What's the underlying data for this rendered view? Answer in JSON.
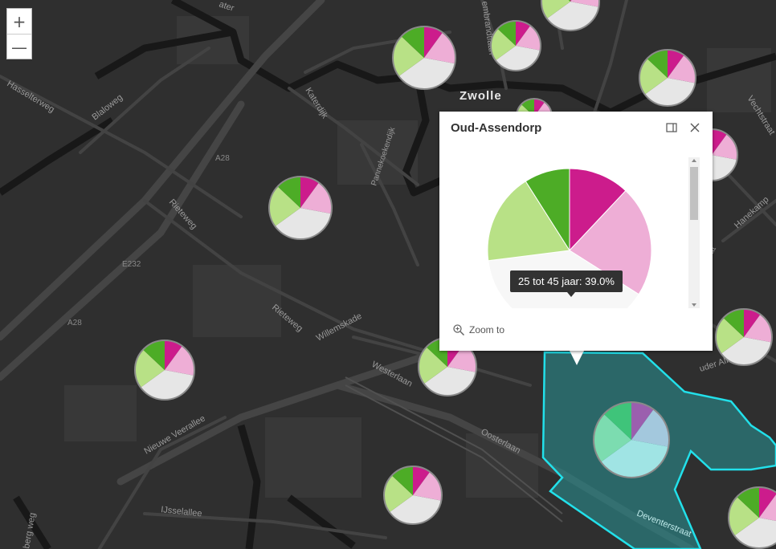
{
  "map": {
    "city_label": "Zwolle",
    "street_labels": [
      "Hasselterweg",
      "Blaloweg",
      "Katerdijk",
      "A28",
      "Pannekoekendijk",
      "Rieteweg",
      "E232",
      "A28",
      "Rieteweg",
      "Willemskade",
      "Westerlaan",
      "Oosterlaan",
      "Nieuwe Veerallee",
      "IJsselallee",
      "berg weg",
      "Deventerstraat",
      "Hanekamp",
      "Vechtstraat",
      "uder Alferinkweg",
      "kat",
      "ater",
      "embrandtlaan"
    ],
    "colors": {
      "background": "#2f2f2f",
      "highlight_fill": "#2a8d8f",
      "highlight_stroke": "#22e0ea"
    },
    "pie_palette": [
      "#cc1c8c",
      "#eeaed6",
      "#e6e6e6",
      "#b8e186",
      "#4dac26"
    ],
    "pie_palette_selected": [
      "#9b5fae",
      "#a3c8dd",
      "#a0e4e4",
      "#7cdcb0",
      "#3fc47a"
    ]
  },
  "zoom": {
    "in_label": "+",
    "out_label": "—"
  },
  "popup": {
    "title": "Oud-Assendorp",
    "tooltip": "25 tot 45 jaar: 39.0%",
    "zoom_to_label": "Zoom to"
  },
  "chart_data": {
    "type": "pie",
    "title": "Oud-Assendorp",
    "series": [
      {
        "name": "",
        "value": 12.0,
        "color": "#cc1c8c"
      },
      {
        "name": "",
        "value": 22.0,
        "color": "#eeaed6"
      },
      {
        "name": "25 tot 45 jaar",
        "value": 39.0,
        "color": "#f7f7f7"
      },
      {
        "name": "",
        "value": 18.0,
        "color": "#b8e186"
      },
      {
        "name": "",
        "value": 9.0,
        "color": "#4dac26"
      }
    ]
  }
}
